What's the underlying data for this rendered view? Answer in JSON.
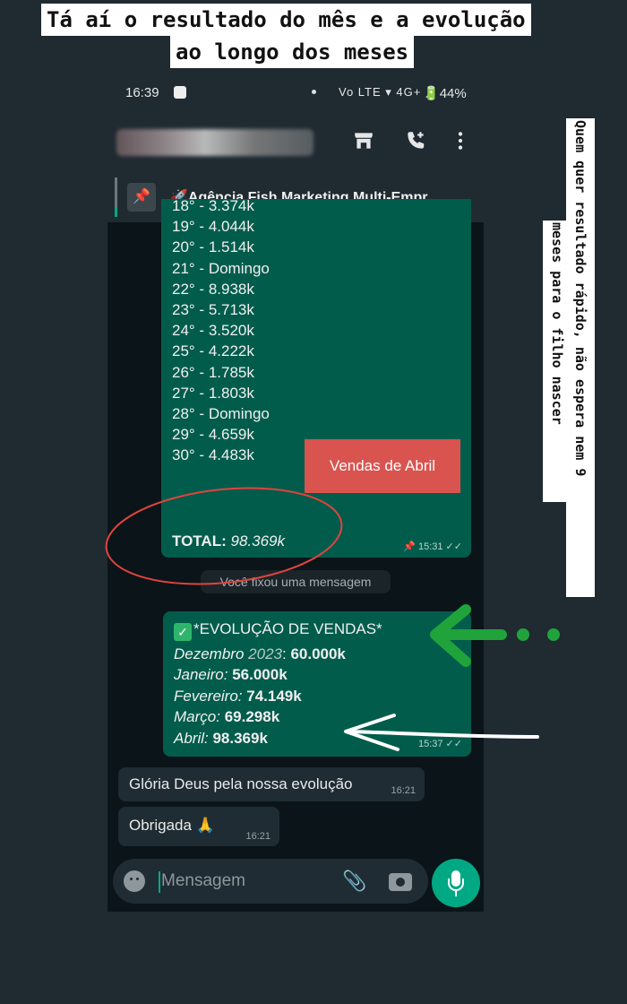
{
  "story_caption": {
    "line1": "Tá aí o resultado do mês e a evolução",
    "line2": "ao longo dos meses"
  },
  "side_caption": {
    "line1": "Quem quer resultado rápido, não espera nem 9",
    "line2": "meses para o filho nascer"
  },
  "status_bar": {
    "time": "16:39",
    "network": "Vo LTE  ▾ 4G+ ◢",
    "battery": "44%"
  },
  "chat_header": {
    "icons": [
      "store-icon",
      "add-call-icon",
      "more-vert-icon"
    ]
  },
  "pinned": {
    "title": "🚀Agência Fish Marketing Multi-Empr..."
  },
  "sales_message": {
    "lines": [
      "18° - 3.374k",
      "19° - 4.044k",
      "20° - 1.514k",
      "21° -  Domingo",
      "22° - 8.938k",
      "23° - 5.713k",
      "24° - 3.520k",
      "25° - 4.222k",
      "26° - 1.785k",
      "27° - 1.803k",
      "28° - Domingo",
      "29° - 4.659k",
      "30° -  4.483k"
    ],
    "total_label": "TOTAL:",
    "total_value": "98.369k",
    "time": "📌 15:31 ✓✓"
  },
  "overlay_label": "Vendas de Abril",
  "system_notice": "Você fixou uma mensagem",
  "evolution_message": {
    "title": "*EVOLUÇÃO DE VENDAS*",
    "rows": [
      {
        "month": "Dezembro",
        "year": "2023",
        "value": "60.000k"
      },
      {
        "month": "Janeiro:",
        "value": "56.000k"
      },
      {
        "month": "Fevereiro:",
        "value": "74.149k"
      },
      {
        "month": "Março:",
        "value": "69.298k"
      },
      {
        "month": "Abril:",
        "value": "98.369k"
      }
    ],
    "time": "15:37 ✓✓"
  },
  "incoming": [
    {
      "text": "Glória Deus pela nossa evolução",
      "time": "16:21"
    },
    {
      "text": "Obrigada 🙏",
      "time": "16:21"
    }
  ],
  "composer": {
    "placeholder": "Mensagem"
  },
  "colors": {
    "outgoing_bubble": "#025c4c",
    "incoming_bubble": "#1f2c33",
    "accent": "#00a884",
    "overlay_red": "#d9534f",
    "annotation_green": "#1fa33a"
  }
}
